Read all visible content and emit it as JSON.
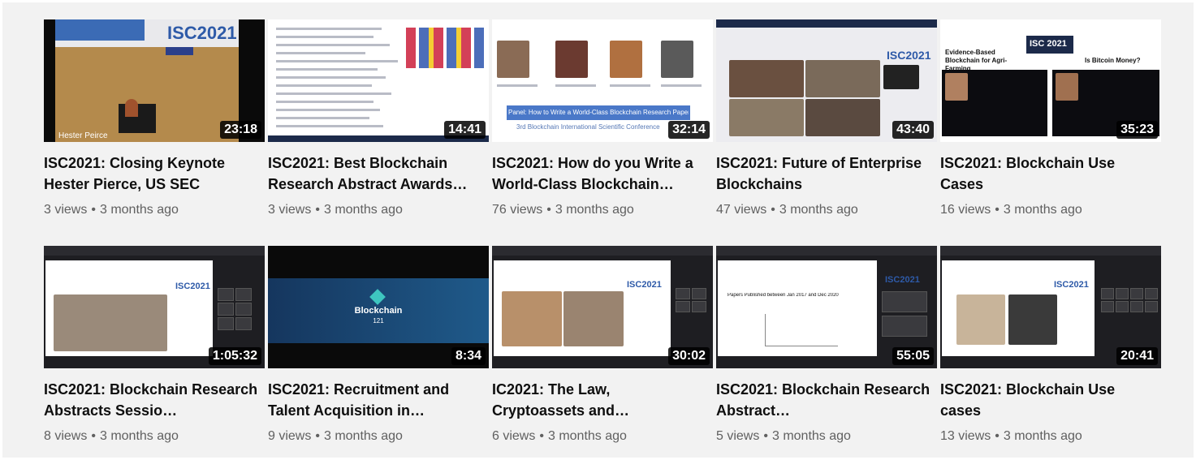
{
  "videos": [
    {
      "title": "ISC2021: Closing Keynote Hester Pierce, US SEC",
      "duration": "23:18",
      "views": "3 views",
      "age": "3 months ago",
      "thumb_text": "ISC2021",
      "thumb_caption": "Hester Peirce"
    },
    {
      "title": "ISC2021: Best Blockchain Research Abstract Awards…",
      "duration": "14:41",
      "views": "3 views",
      "age": "3 months ago"
    },
    {
      "title": "ISC2021: How do you Write a World-Class Blockchain…",
      "duration": "32:14",
      "views": "76 views",
      "age": "3 months ago",
      "thumb_text": "Panel: How to Write a World-Class Blockchain Research Paper",
      "thumb_sub": "3rd Blockchain International Scientific Conference"
    },
    {
      "title": "ISC2021: Future of Enterprise Blockchains",
      "duration": "43:40",
      "views": "47 views",
      "age": "3 months ago",
      "thumb_text": "ISC2021"
    },
    {
      "title": "ISC2021: Blockchain Use Cases",
      "duration": "35:23",
      "views": "16 views",
      "age": "3 months ago",
      "thumb_text": "ISC 2021",
      "thumb_left": "Evidence-Based Blockchain for Agri-Farming",
      "thumb_right": "Is Bitcoin Money?"
    },
    {
      "title": "ISC2021: Blockchain Research Abstracts Sessio…",
      "duration": "1:05:32",
      "views": "8 views",
      "age": "3 months ago",
      "thumb_text": "ISC2021"
    },
    {
      "title": "ISC2021: Recruitment and Talent Acquisition in…",
      "duration": "8:34",
      "views": "9 views",
      "age": "3 months ago",
      "thumb_text": "Blockchain",
      "thumb_sub": "121"
    },
    {
      "title": "IC2021: The Law, Cryptoassets and…",
      "duration": "30:02",
      "views": "6 views",
      "age": "3 months ago",
      "thumb_text": "ISC2021"
    },
    {
      "title": "ISC2021: Blockchain Research Abstract…",
      "duration": "55:05",
      "views": "5 views",
      "age": "3 months ago",
      "thumb_text": "ISC2021",
      "thumb_sub": "Papers Published between Jan 2017 and Dec 2020"
    },
    {
      "title": "ISC2021: Blockchain Use cases",
      "duration": "20:41",
      "views": "13 views",
      "age": "3 months ago",
      "thumb_text": "ISC2021"
    }
  ],
  "colors": {
    "accent": "#3b6bb5",
    "duration_bg": "#000000",
    "title": "#0f0f0f",
    "meta": "#606060"
  }
}
